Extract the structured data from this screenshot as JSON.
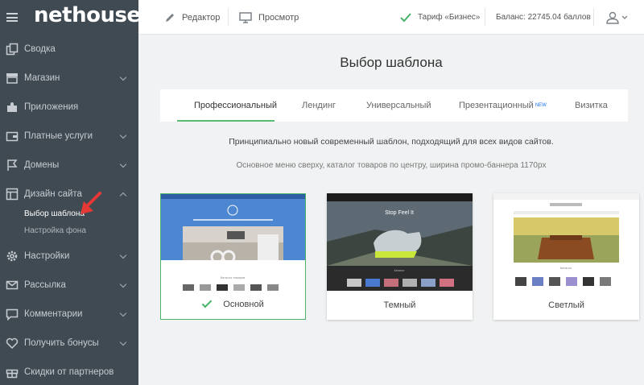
{
  "brand": {
    "logo": "nethouse"
  },
  "sidebar": {
    "items": [
      {
        "label": "Сводка",
        "icon": "copy-icon",
        "chevron": false
      },
      {
        "label": "Магазин",
        "icon": "store-icon",
        "chevron": true
      },
      {
        "label": "Приложения",
        "icon": "puzzle-icon",
        "chevron": false
      },
      {
        "label": "Платные услуги",
        "icon": "wallet-icon",
        "chevron": true
      },
      {
        "label": "Домены",
        "icon": "flag-icon",
        "chevron": true
      },
      {
        "label": "Дизайн сайта",
        "icon": "layout-icon",
        "chevron": true,
        "expanded": true
      },
      {
        "label": "Настройки",
        "icon": "gear-icon",
        "chevron": true
      },
      {
        "label": "Рассылка",
        "icon": "mail-icon",
        "chevron": true
      },
      {
        "label": "Комментарии",
        "icon": "comment-icon",
        "chevron": true
      },
      {
        "label": "Получить бонусы",
        "icon": "heart-icon",
        "chevron": true
      },
      {
        "label": "Скидки от партнеров",
        "icon": "gift-icon",
        "chevron": false
      }
    ],
    "subitems": [
      {
        "label": "Выбор шаблона",
        "active": true
      },
      {
        "label": "Настройка фона",
        "active": false
      }
    ]
  },
  "topbar": {
    "editor": "Редактор",
    "preview": "Просмотр",
    "tariff": "Тариф «Бизнес»",
    "balance": "Баланс: 22745.04 баллов"
  },
  "main": {
    "title": "Выбор шаблона",
    "tabs": [
      {
        "label": "Профессиональный",
        "active": true
      },
      {
        "label": "Лендинг"
      },
      {
        "label": "Универсальный"
      },
      {
        "label": "Презентационный",
        "badge": "NEW"
      },
      {
        "label": "Визитка"
      }
    ],
    "description": "Принципиально новый современный шаблон, подходящий для всех видов сайтов.",
    "details": "Основное меню сверху, каталог товаров по центру, ширина промо-баннера 1170px",
    "templates": [
      {
        "label": "Основной",
        "selected": true,
        "catalog": "Каталог товаров"
      },
      {
        "label": "Темный",
        "selected": false,
        "banner": "Stop Feel It"
      },
      {
        "label": "Светлый",
        "selected": false,
        "catalog": "Каталог"
      }
    ]
  },
  "colors": {
    "sidebar_bg": "#404a52",
    "accent": "#49b36a",
    "arrow": "#e53935"
  }
}
